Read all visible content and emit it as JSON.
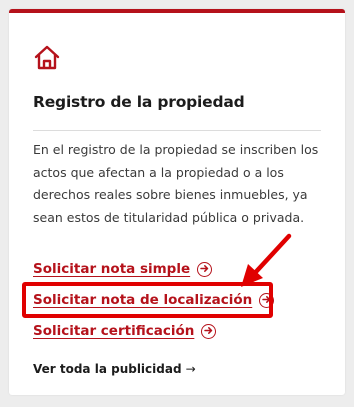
{
  "card": {
    "icon": "home-icon",
    "title": "Registro de la propiedad",
    "description": "En el registro de la propiedad se inscriben los actos que afectan a la propiedad o a los derechos reales sobre bienes inmuebles, ya sean estos de titularidad pública o privada.",
    "links": [
      {
        "label": "Solicitar nota simple",
        "icon": "arrow-circle-icon"
      },
      {
        "label": "Solicitar nota de localización",
        "icon": "arrow-circle-icon"
      },
      {
        "label": "Solicitar certificación",
        "icon": "arrow-circle-icon"
      }
    ],
    "see_all": {
      "label": "Ver toda la publicidad",
      "arrow": "→"
    }
  },
  "colors": {
    "accent": "#b5121b",
    "highlight": "#e00000",
    "background": "#ededed"
  }
}
